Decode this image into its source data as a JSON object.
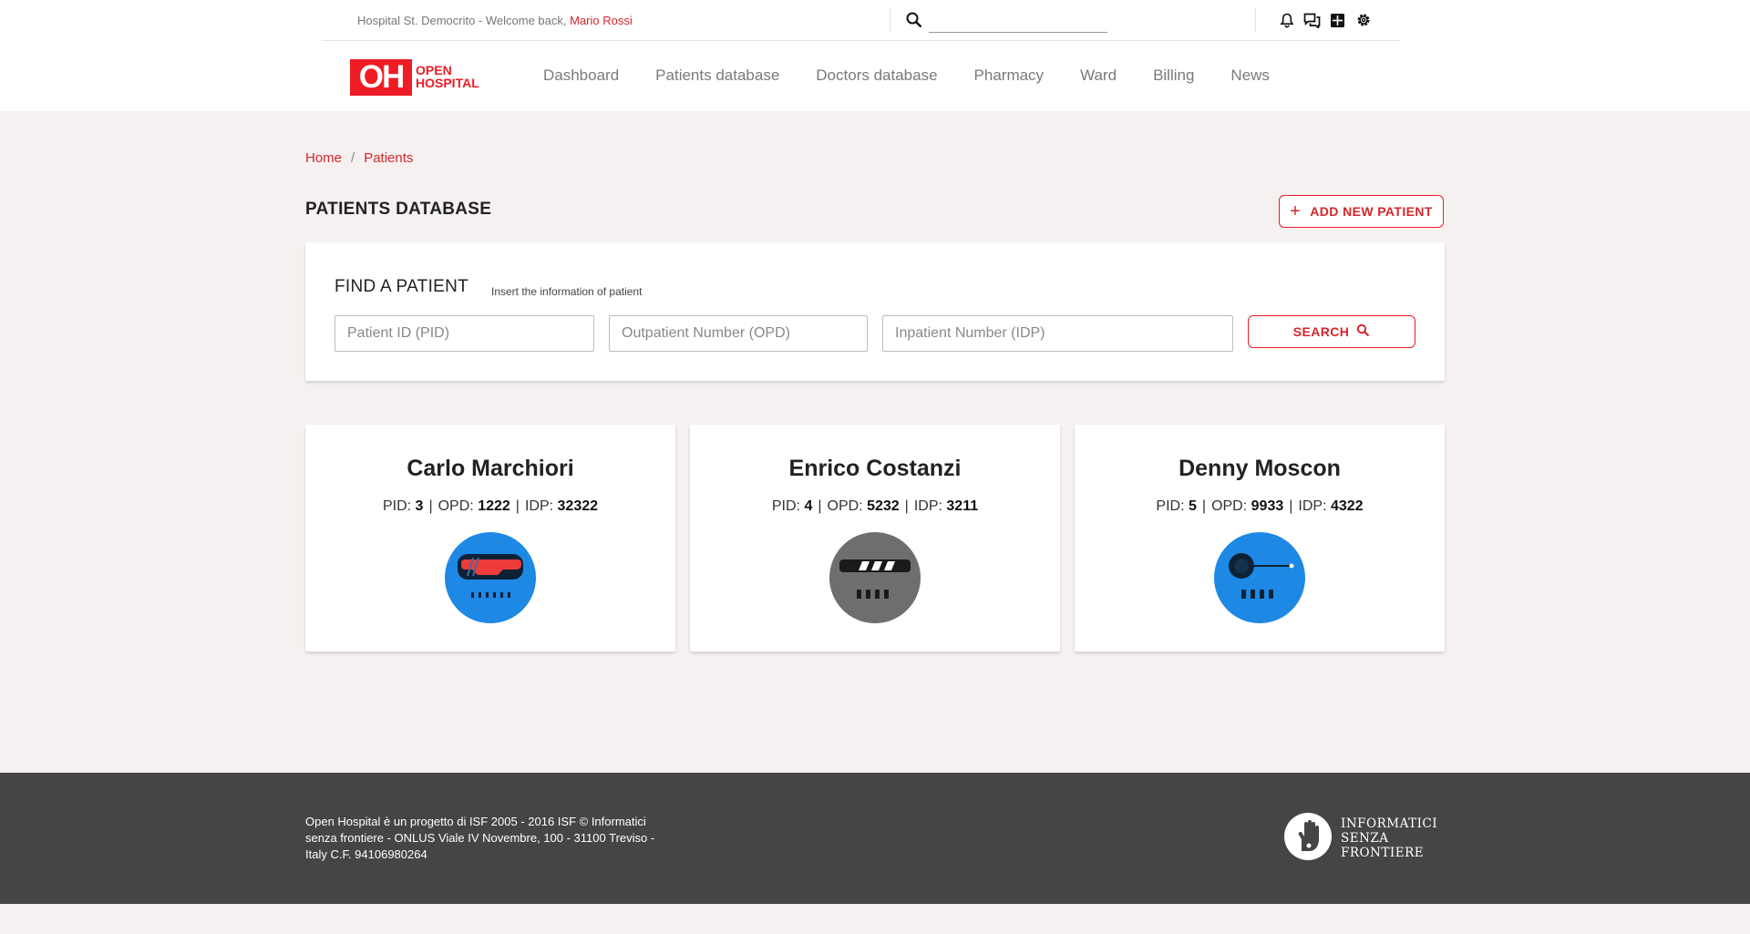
{
  "topbar": {
    "welcome_text": "Hospital St. Democrito - Welcome back,",
    "user_name": "Mario Rossi",
    "search_placeholder": ""
  },
  "logo": {
    "mark": "OH",
    "line1": "OPEN",
    "line2": "HOSPITAL"
  },
  "nav": {
    "items": [
      {
        "label": "Dashboard"
      },
      {
        "label": "Patients database"
      },
      {
        "label": "Doctors database"
      },
      {
        "label": "Pharmacy"
      },
      {
        "label": "Ward"
      },
      {
        "label": "Billing"
      },
      {
        "label": "News"
      }
    ]
  },
  "breadcrumb": {
    "home": "Home",
    "separator": "/",
    "current": "Patients"
  },
  "page": {
    "title": "PATIENTS DATABASE",
    "add_button": "ADD NEW PATIENT"
  },
  "find": {
    "title": "FIND A PATIENT",
    "subtitle": "Insert the information of patient",
    "pid_placeholder": "Patient ID (PID)",
    "opd_placeholder": "Outpatient Number (OPD)",
    "idp_placeholder": "Inpatient Number (IDP)",
    "search_button": "SEARCH"
  },
  "labels": {
    "pid": "PID:",
    "opd": "OPD:",
    "idp": "IDP:",
    "sep": "|"
  },
  "patients": [
    {
      "name": "Carlo Marchiori",
      "pid": "3",
      "opd": "1222",
      "idp": "32322",
      "avatar_color": "#1e88e5",
      "avatar_icon": "robot-visor-icon"
    },
    {
      "name": "Enrico Costanzi",
      "pid": "4",
      "opd": "5232",
      "idp": "3211",
      "avatar_color": "#6e6e6e",
      "avatar_icon": "robot-striped-visor-icon"
    },
    {
      "name": "Denny Moscon",
      "pid": "5",
      "opd": "9933",
      "idp": "4322",
      "avatar_color": "#1e88e5",
      "avatar_icon": "robot-eye-icon"
    }
  ],
  "footer": {
    "text": "Open Hospital è un progetto di ISF 2005 - 2016 ISF © Informatici senza frontiere - ONLUS Viale IV Novembre, 100 - 31100 Treviso - Italy C.F. 94106980264",
    "org_line1": "INFORMATICI",
    "org_line2": "SENZA",
    "org_line3": "FRONTIERE"
  },
  "colors": {
    "accent": "#ee1c25",
    "background": "#f5f1f0",
    "footer": "#454545"
  }
}
